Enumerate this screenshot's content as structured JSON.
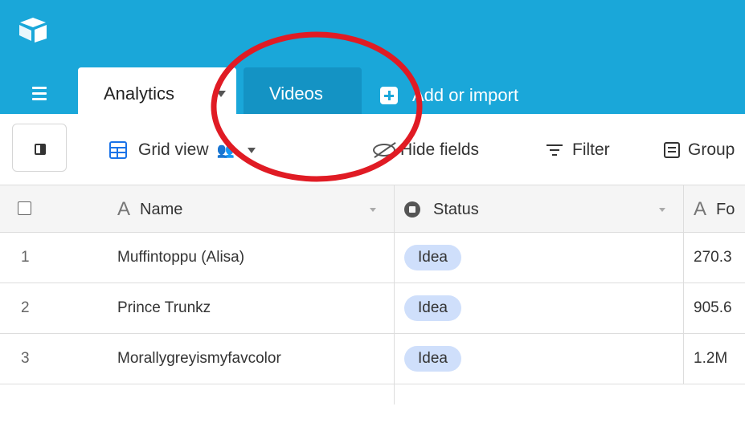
{
  "header": {
    "tabs": [
      {
        "label": "Analytics",
        "active": true
      },
      {
        "label": "Videos",
        "active": false
      }
    ],
    "add_import_label": "Add or import"
  },
  "toolbar": {
    "view_label": "Grid view",
    "hide_fields_label": "Hide fields",
    "filter_label": "Filter",
    "group_label": "Group"
  },
  "grid": {
    "columns": [
      {
        "label": "Name",
        "type_icon": "text-type-icon"
      },
      {
        "label": "Status",
        "type_icon": "single-select-icon"
      },
      {
        "label": "Fo",
        "type_icon": "text-type-icon"
      }
    ],
    "rows": [
      {
        "num": "1",
        "name": "Muffintoppu (Alisa)",
        "status": "Idea",
        "value": "270.3"
      },
      {
        "num": "2",
        "name": "Prince Trunkz",
        "status": "Idea",
        "value": "905.6"
      },
      {
        "num": "3",
        "name": "Morallygreyismyfavcolor",
        "status": "Idea",
        "value": "1.2M"
      }
    ]
  },
  "colors": {
    "header_bg": "#1aa7d9",
    "inactive_tab_bg": "#1493c4",
    "status_pill_bg": "#cfdffb",
    "annotation_red": "#e01b24"
  }
}
